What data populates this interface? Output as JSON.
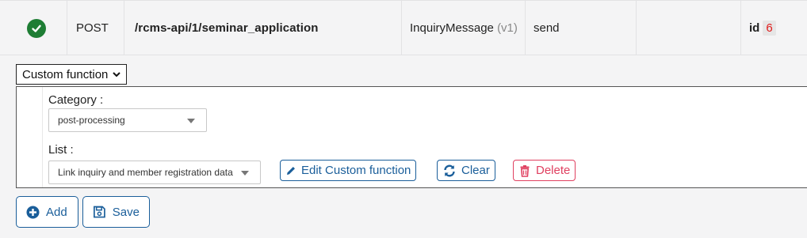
{
  "route": {
    "status_icon": "check-circle-icon",
    "method": "POST",
    "path": "/rcms-api/1/seminar_application",
    "model_name": "InquiryMessage",
    "model_version": "(v1)",
    "operation": "send",
    "id_label": "id",
    "id_value": "6"
  },
  "config": {
    "type_select": "Custom function",
    "category_label": "Category :",
    "category_value": "post-processing",
    "list_label": "List :",
    "list_value": "Link inquiry and member registration data",
    "edit_label": "Edit Custom function",
    "clear_label": "Clear",
    "delete_label": "Delete"
  },
  "footer": {
    "add_label": "Add",
    "save_label": "Save"
  },
  "colors": {
    "success": "#1e7d34",
    "primary": "#1a5e9a",
    "danger": "#e04060",
    "id_badge_text": "#e01b1b"
  }
}
